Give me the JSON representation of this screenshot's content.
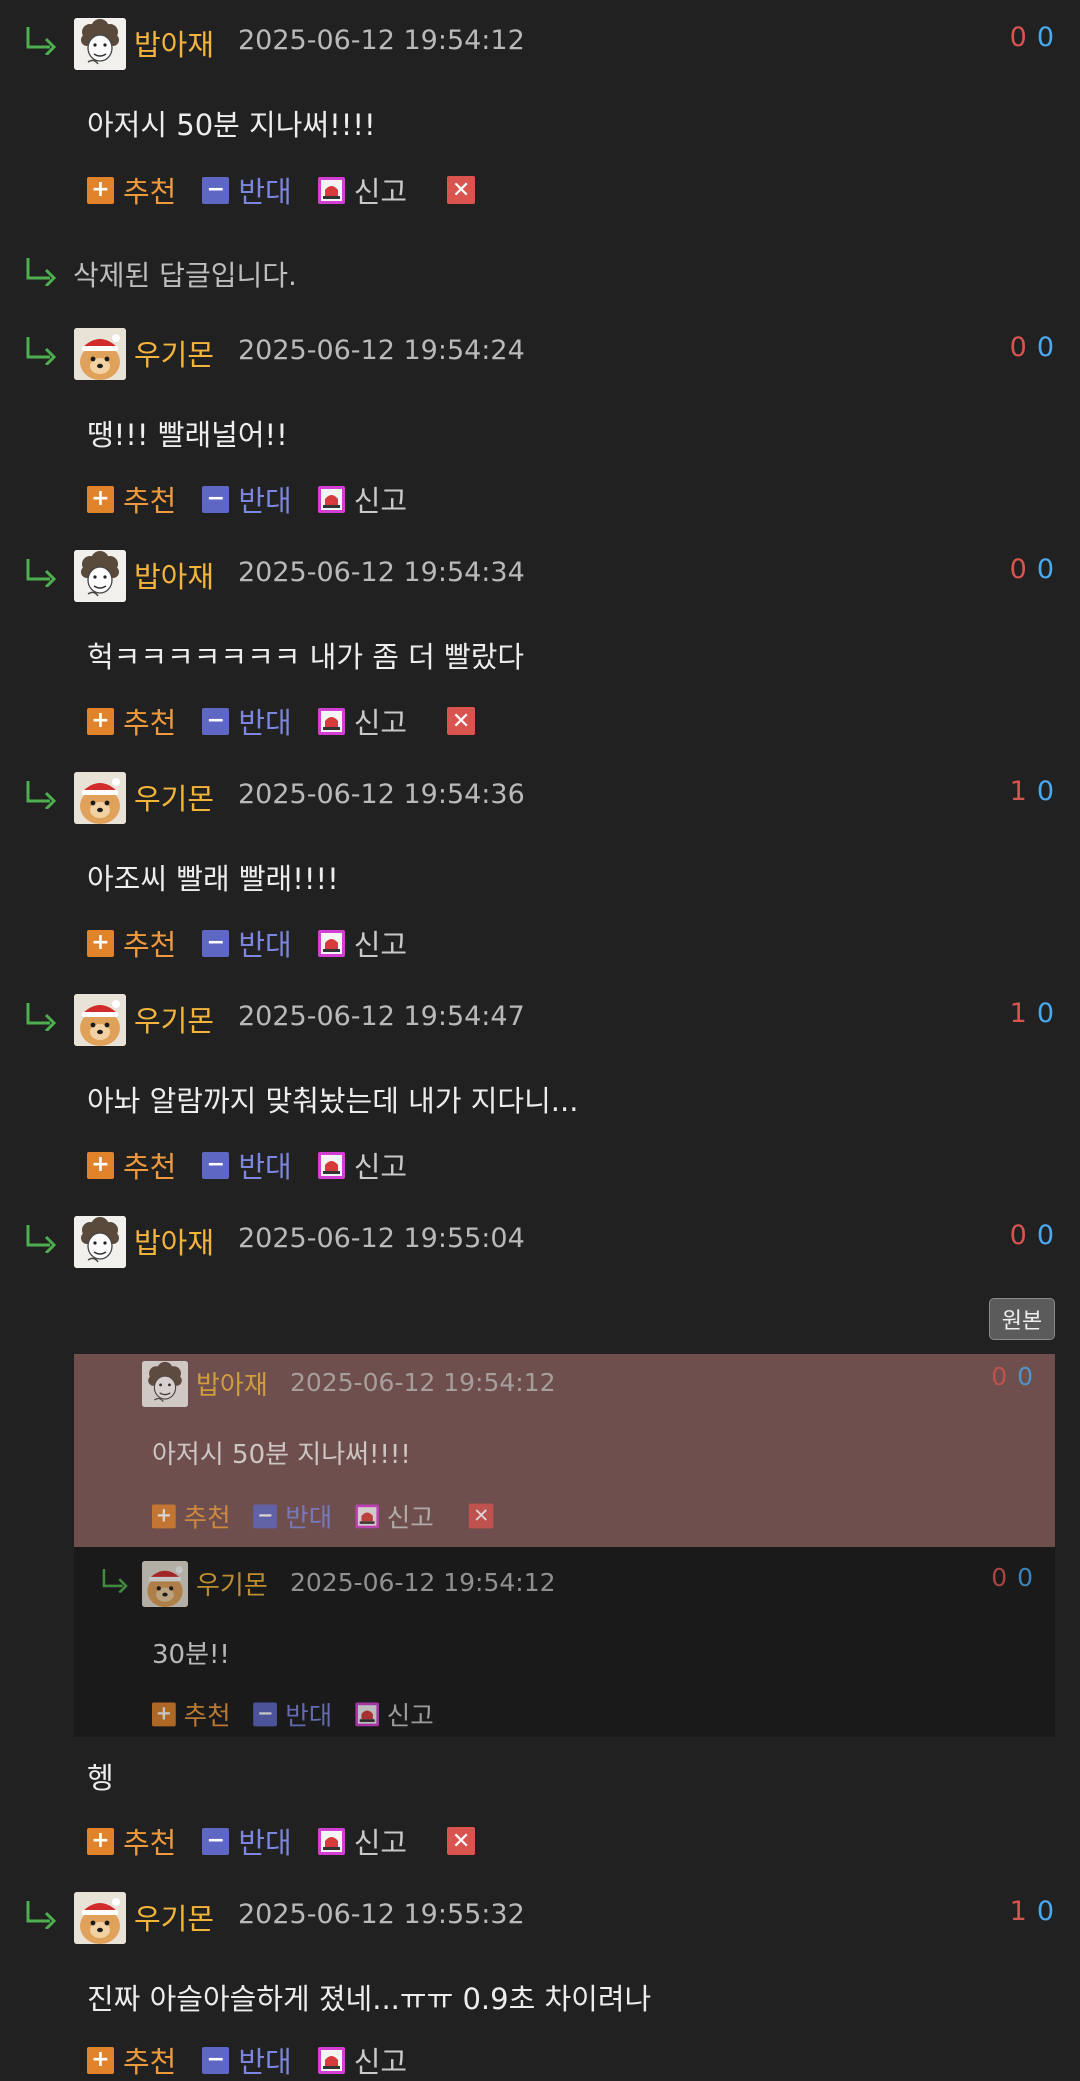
{
  "actions": {
    "recommend": "추천",
    "oppose": "반대",
    "report": "신고",
    "delete": "✕"
  },
  "comments": [
    {
      "nick": "밥아재",
      "date": "2025-06-12 19:54:12",
      "up": "0",
      "down": "0",
      "text": "아저시 50분 지나써!!!!"
    },
    {
      "deleted_text": "삭제된 답글입니다."
    },
    {
      "nick": "우기몬",
      "date": "2025-06-12 19:54:24",
      "up": "0",
      "down": "0",
      "text": "땡!!! 빨래널어!!"
    },
    {
      "nick": "밥아재",
      "date": "2025-06-12 19:54:34",
      "up": "0",
      "down": "0",
      "text": "헉ㅋㅋㅋㅋㅋㅋㅋ 내가 좀 더 빨랐다"
    },
    {
      "nick": "우기몬",
      "date": "2025-06-12 19:54:36",
      "up": "1",
      "down": "0",
      "text": "아조씨 빨래 빨래!!!!"
    },
    {
      "nick": "우기몬",
      "date": "2025-06-12 19:54:47",
      "up": "1",
      "down": "0",
      "text": "아놔 알람까지 맞춰놨는데 내가 지다니..."
    },
    {
      "nick": "밥아재",
      "date": "2025-06-12 19:55:04",
      "up": "0",
      "down": "0",
      "text": "헹",
      "original_button": "원본"
    },
    {
      "nick": "우기몬",
      "date": "2025-06-12 19:55:32",
      "up": "1",
      "down": "0",
      "text": "진짜 아슬아슬하게 졌네...ㅠㅠ 0.9초 차이려나"
    }
  ],
  "quoted": [
    {
      "nick": "밥아재",
      "date": "2025-06-12 19:54:12",
      "up": "0",
      "down": "0",
      "text": "아저시 50분 지나써!!!!"
    },
    {
      "nick": "우기몬",
      "date": "2025-06-12 19:54:12",
      "up": "0",
      "down": "0",
      "text": "30분!!"
    }
  ],
  "icons": {
    "reply_arrow": "reply-arrow-icon",
    "avatar_babajae": "curly-hair-character",
    "avatar_ugimon": "santa-hat-dog",
    "recommend": "plus-icon",
    "oppose": "minus-icon",
    "report": "siren-icon",
    "delete": "close-icon"
  },
  "colors": {
    "background": "#212121",
    "nick": "#f3b43d",
    "upvote": "#d9534f",
    "downvote": "#4aa9ee",
    "recommend": "#e0832b",
    "oppose": "#5e67c4",
    "report": "#d43fd3",
    "quote_bg": "#6e4f4d"
  }
}
